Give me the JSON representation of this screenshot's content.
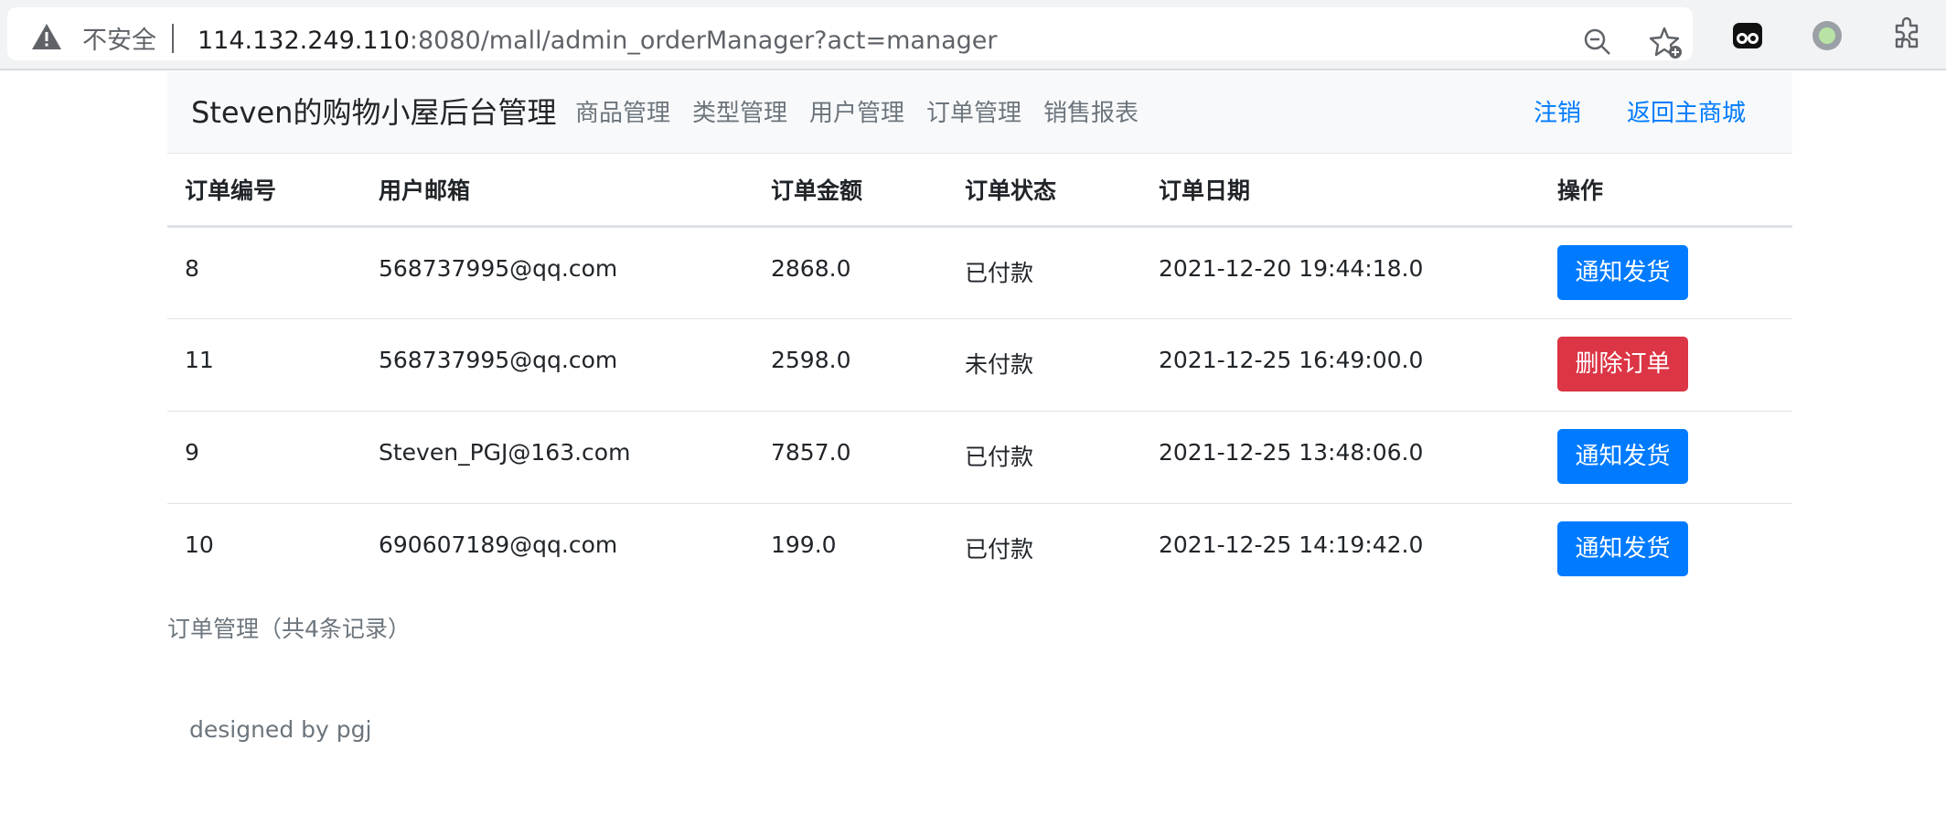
{
  "browser": {
    "security_label": "不安全",
    "url_host": "114.132.249.110",
    "url_rest": ":8080/mall/admin_orderManager?act=manager",
    "icons": [
      "warning-icon",
      "zoom-out-icon",
      "add-favorite-icon",
      "extension-icon",
      "profile-icon",
      "extensions-puzzle-icon"
    ]
  },
  "navbar": {
    "brand": "Steven的购物小屋后台管理",
    "links": [
      "商品管理",
      "类型管理",
      "用户管理",
      "订单管理",
      "销售报表"
    ],
    "right_links": [
      "注销",
      "返回主商城"
    ]
  },
  "table": {
    "headers": [
      "订单编号",
      "用户邮箱",
      "订单金额",
      "订单状态",
      "订单日期",
      "操作"
    ],
    "rows": [
      {
        "id": "8",
        "email": "568737995@qq.com",
        "amount": "2868.0",
        "status": "已付款",
        "date": "2021-12-20 19:44:18.0",
        "action": "通知发货",
        "action_color": "#007bff"
      },
      {
        "id": "11",
        "email": "568737995@qq.com",
        "amount": "2598.0",
        "status": "未付款",
        "date": "2021-12-25 16:49:00.0",
        "action": "删除订单",
        "action_color": "#dc3545"
      },
      {
        "id": "9",
        "email": "Steven_PGJ@163.com",
        "amount": "7857.0",
        "status": "已付款",
        "date": "2021-12-25 13:48:06.0",
        "action": "通知发货",
        "action_color": "#007bff"
      },
      {
        "id": "10",
        "email": "690607189@qq.com",
        "amount": "199.0",
        "status": "已付款",
        "date": "2021-12-25 14:19:42.0",
        "action": "通知发货",
        "action_color": "#007bff"
      }
    ]
  },
  "summary": "订单管理（共4条记录）",
  "footer": "designed by pgj",
  "colors": {
    "primary": "#007bff",
    "danger": "#dc3545",
    "muted": "#6c757d"
  }
}
